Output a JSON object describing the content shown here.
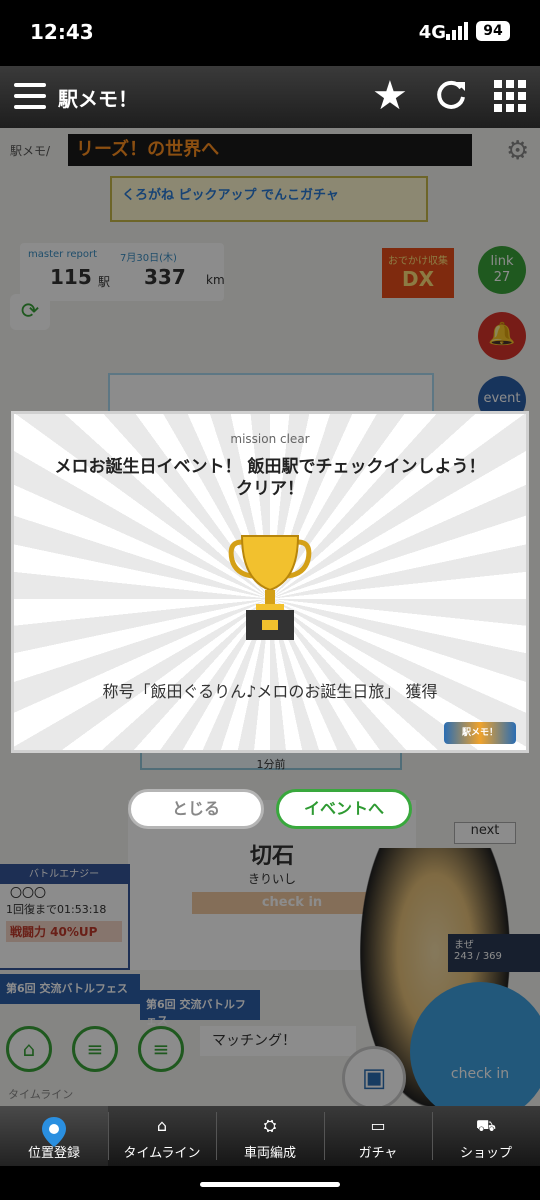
{
  "status_bar": {
    "time": "12:43",
    "network": "4G",
    "battery": "94"
  },
  "app_bar": {
    "title": "駅メモ！"
  },
  "background": {
    "ekimemo_small": "駅メモ/",
    "ticker": "リーズ！の世界へ",
    "banner": "くろがね ピックアップ でんこガチャ",
    "report": {
      "label": "master report",
      "date": "7月30日(木)",
      "stations": "115",
      "stations_unit": "駅",
      "distance": "337",
      "distance_unit": "km"
    },
    "odekake": {
      "top": "おでかけ収集",
      "big": "DX"
    },
    "link": {
      "label": "link",
      "count": "27"
    },
    "event_label": "event",
    "card_time": "1分前",
    "next_label": "next",
    "station": {
      "name": "切石",
      "kana": "きりいし",
      "checkin": "check in",
      "time": "1分前"
    },
    "battle": {
      "header": "バトルエナジー",
      "circles": "〇〇〇",
      "recover": "1回復まで01:53:18",
      "power": "戦闘力 40%UP"
    },
    "fes_label": "第6回 交流バトルフェス",
    "progress": {
      "label": "まぜ",
      "value": "243 / 369"
    },
    "matching": "マッチング！",
    "bigcheck": "check in",
    "timeline_label": "タイムライン"
  },
  "modal": {
    "caption": "mission clear",
    "message_line1": "メロお誕生日イベント！ 飯田駅でチェックインしよう！",
    "message_line2": "クリア！",
    "reward": "称号「飯田ぐるりん♪メロのお誕生日旅」 獲得",
    "logo": "駅メモ！"
  },
  "buttons": {
    "close": "とじる",
    "event": "イベントへ"
  },
  "tabs": [
    {
      "label": "位置登録",
      "icon": "location-pin-icon"
    },
    {
      "label": "タイムライン",
      "icon": "home-icon"
    },
    {
      "label": "車両編成",
      "icon": "train-icon"
    },
    {
      "label": "ガチャ",
      "icon": "ticket-icon"
    },
    {
      "label": "ショップ",
      "icon": "cart-icon"
    }
  ],
  "colors": {
    "accent_green": "#39a83d",
    "tab_bar": "#2a2a2a",
    "pin_blue": "#2a8fe0"
  }
}
